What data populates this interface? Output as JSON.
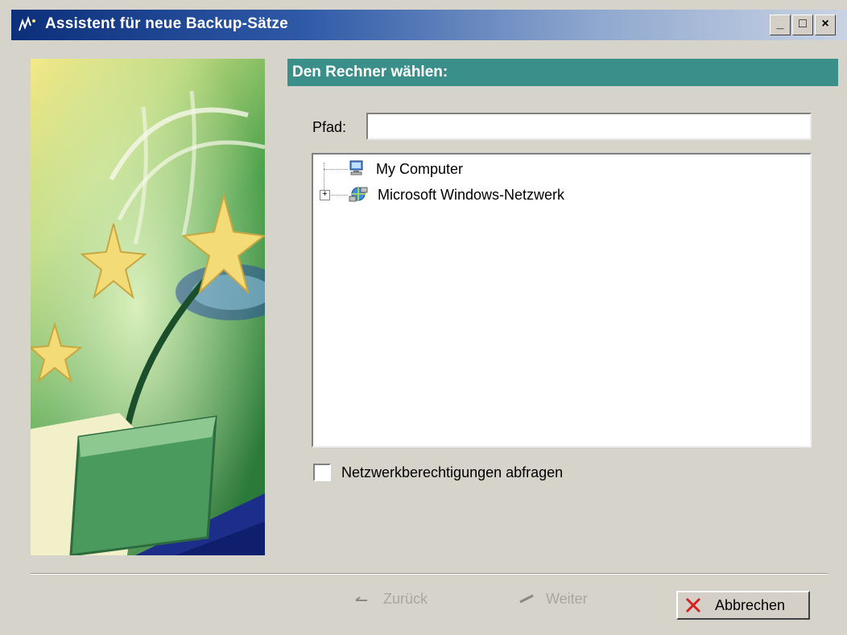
{
  "window": {
    "title": "Assistent für neue Backup-Sätze",
    "minimize_label": "_",
    "maximize_label": "□",
    "close_label": "×"
  },
  "header": {
    "title": "Den Rechner wählen:"
  },
  "path": {
    "label": "Pfad:",
    "value": ""
  },
  "tree": {
    "items": [
      {
        "label": "My Computer",
        "icon": "computer-icon",
        "expandable": false
      },
      {
        "label": "Microsoft Windows-Netzwerk",
        "icon": "network-icon",
        "expandable": true
      }
    ]
  },
  "options": {
    "network_permissions_label": "Netzwerkberechtigungen abfragen",
    "network_permissions_checked": false
  },
  "buttons": {
    "back_label": "Zurück",
    "next_label": "Weiter",
    "cancel_label": "Abbrechen"
  },
  "colors": {
    "header_bg": "#3a8f8a",
    "title_gradient_start": "#0c2f7a"
  }
}
